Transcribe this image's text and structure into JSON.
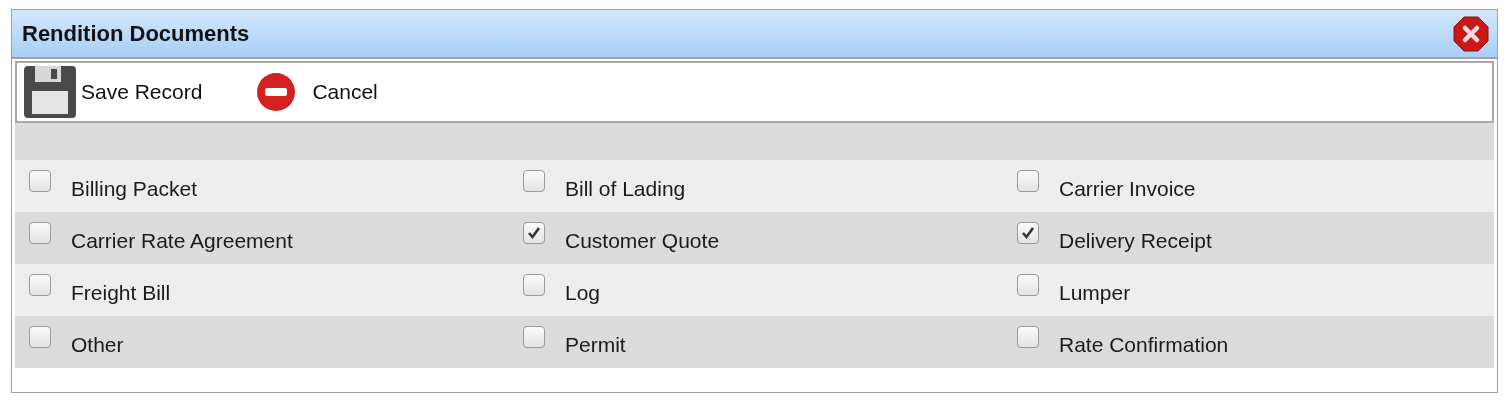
{
  "window": {
    "title": "Rendition Documents"
  },
  "toolbar": [
    {
      "kind": "save",
      "label": "Save Record"
    },
    {
      "kind": "cancel",
      "label": "Cancel"
    }
  ],
  "documents": [
    {
      "label": "Billing Packet",
      "checked": false
    },
    {
      "label": "Bill of Lading",
      "checked": false
    },
    {
      "label": "Carrier Invoice",
      "checked": false
    },
    {
      "label": "Carrier Rate Agreement",
      "checked": false
    },
    {
      "label": "Customer Quote",
      "checked": true
    },
    {
      "label": "Delivery Receipt",
      "checked": true
    },
    {
      "label": "Freight Bill",
      "checked": false
    },
    {
      "label": "Log",
      "checked": false
    },
    {
      "label": "Lumper",
      "checked": false
    },
    {
      "label": "Other",
      "checked": false
    },
    {
      "label": "Permit",
      "checked": false
    },
    {
      "label": "Rate Confirmation",
      "checked": false
    }
  ]
}
